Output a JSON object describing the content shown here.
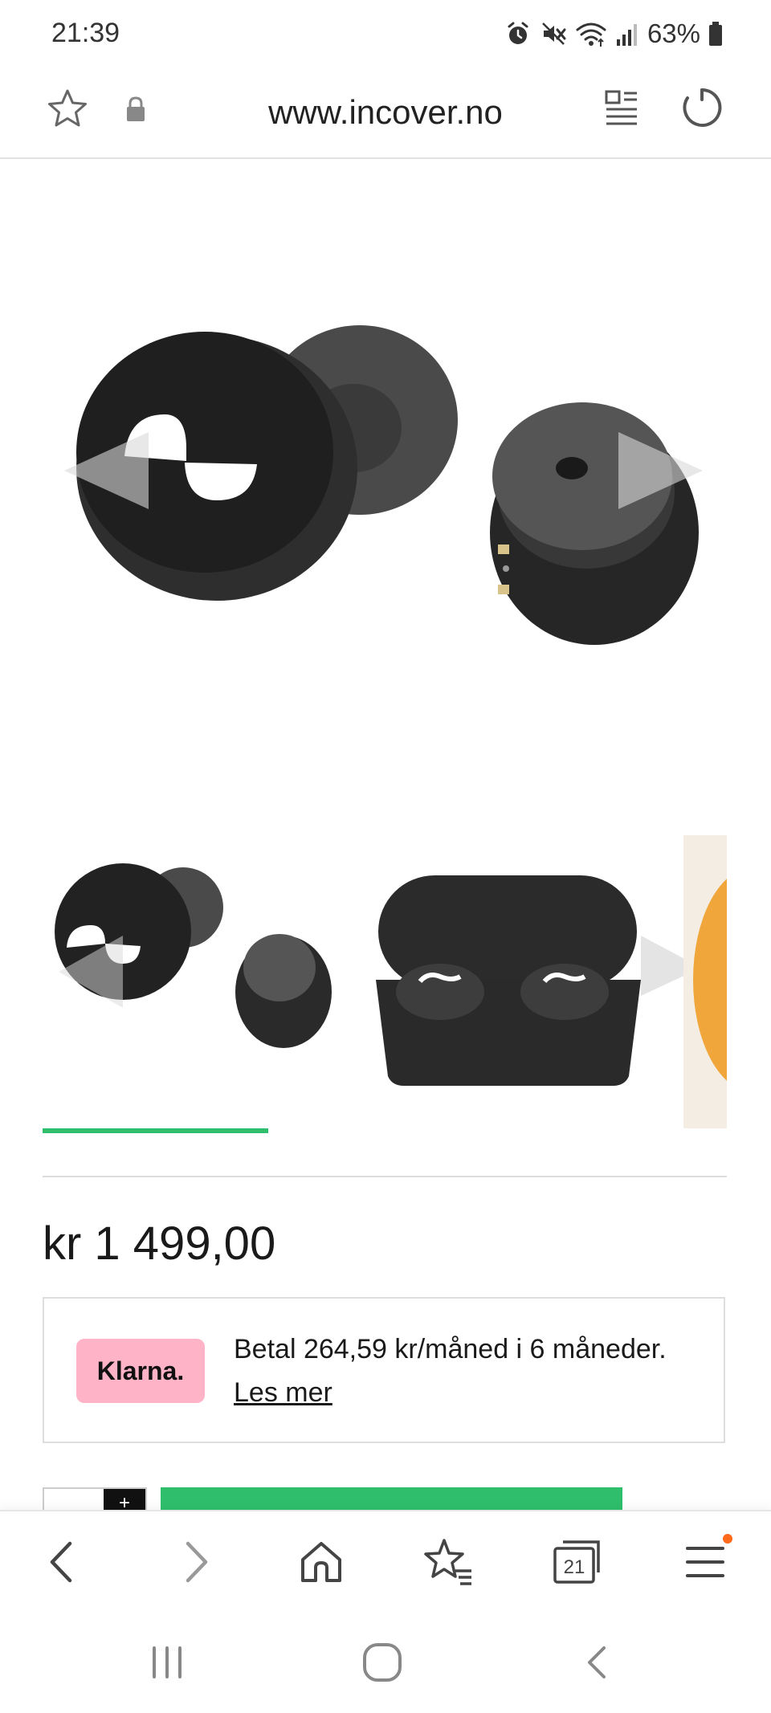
{
  "status_bar": {
    "time": "21:39",
    "battery_percent": "63%",
    "icons": [
      "alarm-icon",
      "mute-icon",
      "wifi-icon",
      "signal-icon",
      "battery-icon"
    ]
  },
  "browser": {
    "url": "www.incover.no",
    "icons": [
      "star-icon",
      "lock-icon",
      "reader-mode-icon",
      "reload-icon"
    ]
  },
  "product": {
    "price": "kr 1 499,00",
    "gallery_progress": 0.33,
    "thumbnails": [
      "earbuds-thumbnail",
      "charging-case-thumbnail",
      "partial-thumbnail"
    ]
  },
  "klarna": {
    "logo": "Klarna.",
    "text": "Betal 264,59 kr/måned i 6 måneder.",
    "link": "Les mer",
    "badge_color": "#ffb3c7"
  },
  "accent_color": "#2fbf6c",
  "quantity": {
    "plus": "+"
  },
  "bottom_toolbar": {
    "tab_count": "21",
    "icons": [
      "back-icon",
      "forward-icon",
      "home-icon",
      "bookmarks-icon",
      "tabs-icon",
      "menu-icon"
    ]
  },
  "system_nav": {
    "icons": [
      "recents-icon",
      "home-circle-icon",
      "system-back-icon"
    ]
  }
}
